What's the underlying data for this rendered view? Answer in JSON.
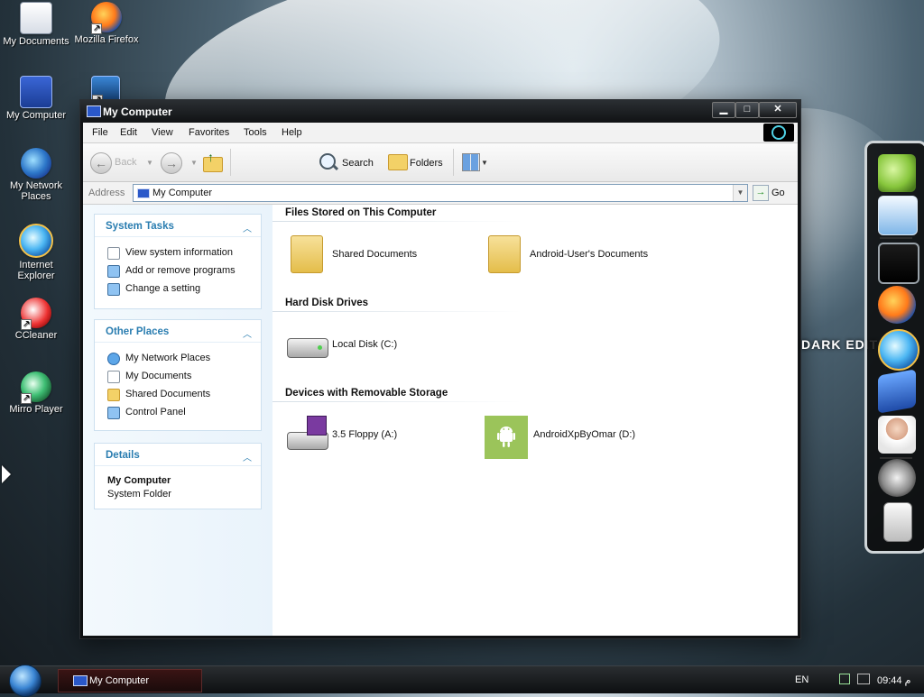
{
  "desktop": {
    "icons": [
      {
        "label": "My Documents",
        "icon": "my-documents-icon"
      },
      {
        "label": "Mozilla Firefox",
        "icon": "firefox-icon"
      },
      {
        "label": "My Computer",
        "icon": "my-computer-icon"
      },
      {
        "label": "My Network Places",
        "icon": "network-places-icon"
      },
      {
        "label": "Internet Explorer",
        "icon": "internet-explorer-icon"
      },
      {
        "label": "CCleaner",
        "icon": "ccleaner-icon"
      },
      {
        "label": "Mirro Player",
        "icon": "mirro-player-icon"
      }
    ],
    "dock_overlay_text": "DARK EDIT",
    "dock_items": [
      "android-icon",
      "remote-desktop-icon",
      "tablet-icon",
      "firefox-icon",
      "internet-explorer-icon",
      "facebook-icon",
      "support-icon",
      "settings-gear-icon",
      "recycle-bin-icon"
    ]
  },
  "window": {
    "title": "My Computer",
    "menu": [
      "File",
      "Edit",
      "View",
      "Favorites",
      "Tools",
      "Help"
    ],
    "toolbar": {
      "back": "Back",
      "search": "Search",
      "folders": "Folders"
    },
    "address": {
      "label": "Address",
      "value": "My Computer",
      "go": "Go"
    },
    "task_pane": {
      "system_tasks": {
        "title": "System Tasks",
        "items": [
          "View system information",
          "Add or remove programs",
          "Change a setting"
        ]
      },
      "other_places": {
        "title": "Other Places",
        "items": [
          "My Network Places",
          "My Documents",
          "Shared Documents",
          "Control Panel"
        ]
      },
      "details": {
        "title": "Details",
        "name": "My Computer",
        "type": "System Folder"
      }
    },
    "sections": {
      "files_stored": {
        "title": "Files Stored on This Computer",
        "items": [
          "Shared Documents",
          "Android-User's Documents"
        ]
      },
      "hard_disks": {
        "title": "Hard Disk Drives",
        "items": [
          "Local Disk (C:)"
        ]
      },
      "removable": {
        "title": "Devices with Removable Storage",
        "items": [
          "3.5 Floppy (A:)",
          "AndroidXpByOmar (D:)"
        ]
      }
    }
  },
  "taskbar": {
    "task_label": "My Computer",
    "language": "EN",
    "time": "09:44 م"
  },
  "colors": {
    "accent": "#2a7db0",
    "window_frame": "#101214",
    "task_button": "#3a1414",
    "android_green": "#9bc45a"
  }
}
